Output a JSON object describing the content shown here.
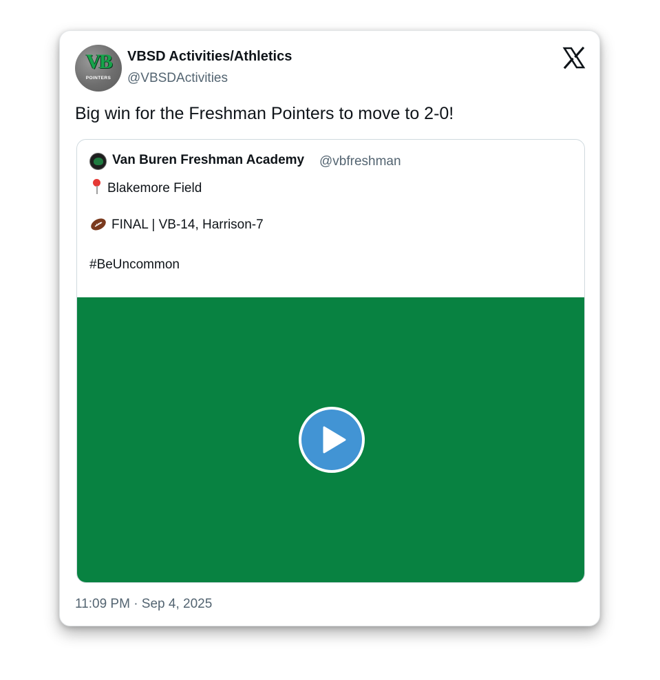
{
  "author": {
    "display_name": "VBSD Activities/Athletics",
    "handle": "@VBSDActivities",
    "avatar": {
      "monogram": "VB",
      "word": "POINTERS",
      "icon": "school-logo-avatar"
    }
  },
  "tweet": {
    "text": "Big win for the Freshman Pointers to move to 2-0!",
    "timestamp": "11:09 PM · Sep 4, 2025"
  },
  "quoted_tweet": {
    "display_name": "Van Buren Freshman Academy",
    "handle": "@vbfreshman",
    "location_line": "Blakemore Field",
    "score_line": "FINAL | VB-14, Harrison-7",
    "hashtag_line": "#BeUncommon"
  },
  "media": {
    "background_color": "#088241",
    "play_icon": "play-icon"
  },
  "icons": {
    "brand": "x-logo-icon",
    "pin": "round-pushpin-icon",
    "football": "football-icon"
  },
  "colors": {
    "text_primary": "#0f1419",
    "text_secondary": "#536471",
    "play_blue": "#4294d4"
  }
}
